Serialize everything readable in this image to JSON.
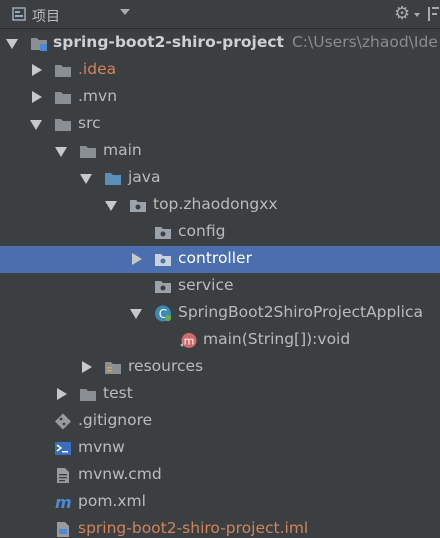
{
  "header": {
    "title": "项目"
  },
  "tree": {
    "project_name": "spring-boot2-shiro-project",
    "project_path": "C:\\Users\\zhaod\\Ide",
    "idea": ".idea",
    "mvn": ".mvn",
    "src": "src",
    "main": "main",
    "java": "java",
    "package": "top.zhaodongxx",
    "config": "config",
    "controller": "controller",
    "service": "service",
    "app_class": "SpringBoot2ShiroProjectApplica",
    "main_method": "main(String[]):void",
    "resources": "resources",
    "test": "test",
    "gitignore": ".gitignore",
    "mvnw": "mvnw",
    "mvnw_cmd": "mvnw.cmd",
    "pom": "pom.xml",
    "iml": "spring-boot2-shiro-project.iml"
  },
  "icon_colors": {
    "folder": "#8a8f93",
    "source_folder": "#5a8fb8",
    "package": "#9aa3ab",
    "class": "#3d8ab5",
    "method": "#d06b6b",
    "maven": "#4d88d5",
    "terminal": "#3a6fbf"
  },
  "selected_item": "controller"
}
